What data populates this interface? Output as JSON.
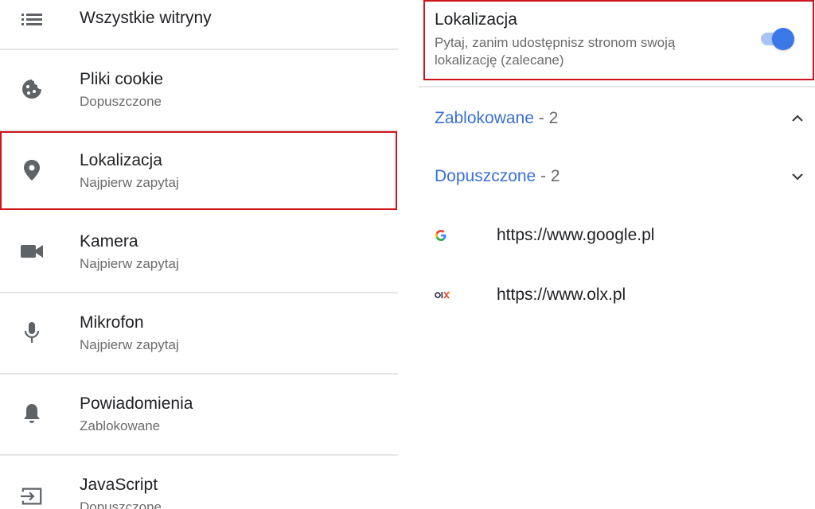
{
  "left_list": {
    "items": [
      {
        "title": "Wszystkie witryny",
        "subtitle": "",
        "icon": "list-icon"
      },
      {
        "title": "Pliki cookie",
        "subtitle": "Dopuszczone",
        "icon": "cookie-icon"
      },
      {
        "title": "Lokalizacja",
        "subtitle": "Najpierw zapytaj",
        "icon": "location-pin-icon"
      },
      {
        "title": "Kamera",
        "subtitle": "Najpierw zapytaj",
        "icon": "camera-icon"
      },
      {
        "title": "Mikrofon",
        "subtitle": "Najpierw zapytaj",
        "icon": "microphone-icon"
      },
      {
        "title": "Powiadomienia",
        "subtitle": "Zablokowane",
        "icon": "bell-icon"
      },
      {
        "title": "JavaScript",
        "subtitle": "Dopuszczone",
        "icon": "javascript-icon"
      }
    ]
  },
  "location_setting": {
    "title": "Lokalizacja",
    "description": "Pytaj, zanim udostępnisz stronom swoją lokalizację (zalecane)",
    "toggle_on": true
  },
  "sections": {
    "blocked": {
      "name": "Zablokowane",
      "count": " - 2",
      "expanded": true
    },
    "allowed": {
      "name": "Dopuszczone",
      "count": " - 2",
      "expanded": false
    }
  },
  "sites": [
    {
      "url": "https://www.google.pl",
      "icon": "google-favicon"
    },
    {
      "url": "https://www.olx.pl",
      "icon": "olx-favicon"
    }
  ],
  "colors": {
    "accent": "#3a78e8",
    "highlight": "#d0141c",
    "link": "#3a6fd8"
  }
}
